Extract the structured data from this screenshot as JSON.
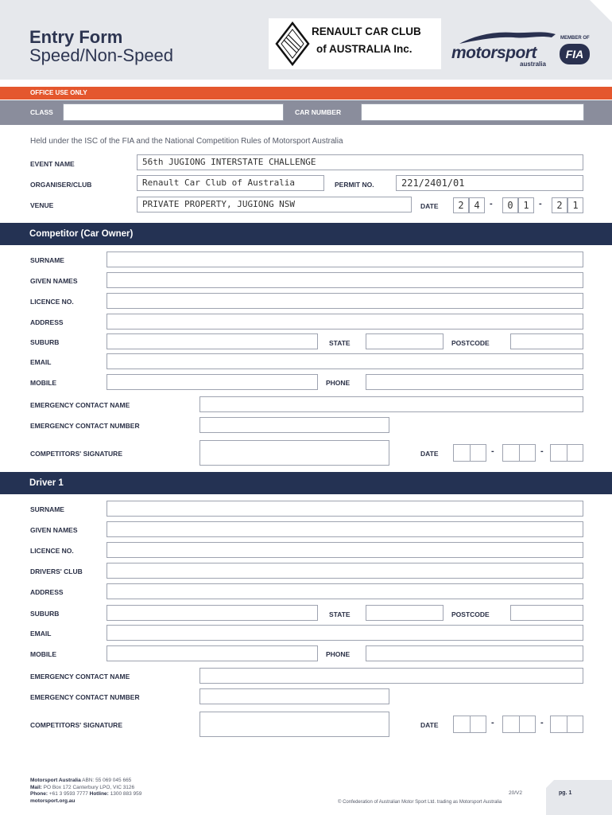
{
  "header": {
    "title_line1": "Entry Form",
    "title_line2": "Speed/Non-Speed",
    "rcc_logo_line1": "RENAULT CAR CLUB",
    "rcc_logo_line2": "of AUSTRALIA Inc.",
    "rcc_emblem_text": "RENAULT CAR CLUB OF AUSTRALIA",
    "ms_logo_word": "motorsport",
    "ms_logo_sub": "australia",
    "fia_member": "MEMBER OF",
    "fia_badge": "FIA"
  },
  "office": {
    "bar_label": "OFFICE USE ONLY",
    "class_label": "CLASS",
    "car_number_label": "CAR NUMBER"
  },
  "intro": "Held under the ISC of the FIA and the National Competition Rules of Motorsport Australia",
  "event": {
    "event_name_label": "EVENT NAME",
    "event_name_value": "56th JUGIONG INTERSTATE CHALLENGE",
    "organiser_label": "ORGANISER/CLUB",
    "organiser_value": "Renault Car Club of Australia",
    "permit_label": "PERMIT NO.",
    "permit_value": "221/2401/01",
    "venue_label": "VENUE",
    "venue_value": "PRIVATE PROPERTY, JUGIONG NSW",
    "date_label": "DATE",
    "date_digits": [
      "2",
      "4",
      "0",
      "1",
      "2",
      "1"
    ],
    "date_sep": "-"
  },
  "competitor": {
    "section_title": "Competitor (Car Owner)",
    "surname": "SURNAME",
    "given_names": "GIVEN NAMES",
    "licence": "LICENCE NO.",
    "address": "ADDRESS",
    "suburb": "SUBURB",
    "state": "STATE",
    "postcode": "POSTCODE",
    "email": "EMAIL",
    "mobile": "MOBILE",
    "phone": "PHONE",
    "emergency_name": "EMERGENCY CONTACT NAME",
    "emergency_number": "EMERGENCY CONTACT NUMBER",
    "signature": "COMPETITORS' SIGNATURE",
    "date": "DATE",
    "sep": "-"
  },
  "driver1": {
    "section_title": "Driver 1",
    "surname": "SURNAME",
    "given_names": "GIVEN NAMES",
    "licence": "LICENCE NO.",
    "drivers_club": "DRIVERS' CLUB",
    "address": "ADDRESS",
    "suburb": "SUBURB",
    "state": "STATE",
    "postcode": "POSTCODE",
    "email": "EMAIL",
    "mobile": "MOBILE",
    "phone": "PHONE",
    "emergency_name": "EMERGENCY CONTACT NAME",
    "emergency_number": "EMERGENCY CONTACT NUMBER",
    "signature": "COMPETITORS' SIGNATURE",
    "date": "DATE",
    "sep": "-"
  },
  "footer": {
    "org_name": "Motorsport Australia",
    "abn": " ABN: 55 069 045 665",
    "mail_label": "Mail:",
    "mail": " PO Box 172 Canterbury LPO, VIC 3126",
    "phone_label": "Phone:",
    "phone": " +61 3 9593 7777 ",
    "hotline_label": "Hotline:",
    "hotline": " 1300 883 959",
    "website": "motorsport.org.au",
    "version": "20/V2",
    "copyright": "© Confederation of Australian Motor Sport Ltd. trading as Motorsport Australia",
    "page": "pg. 1"
  }
}
